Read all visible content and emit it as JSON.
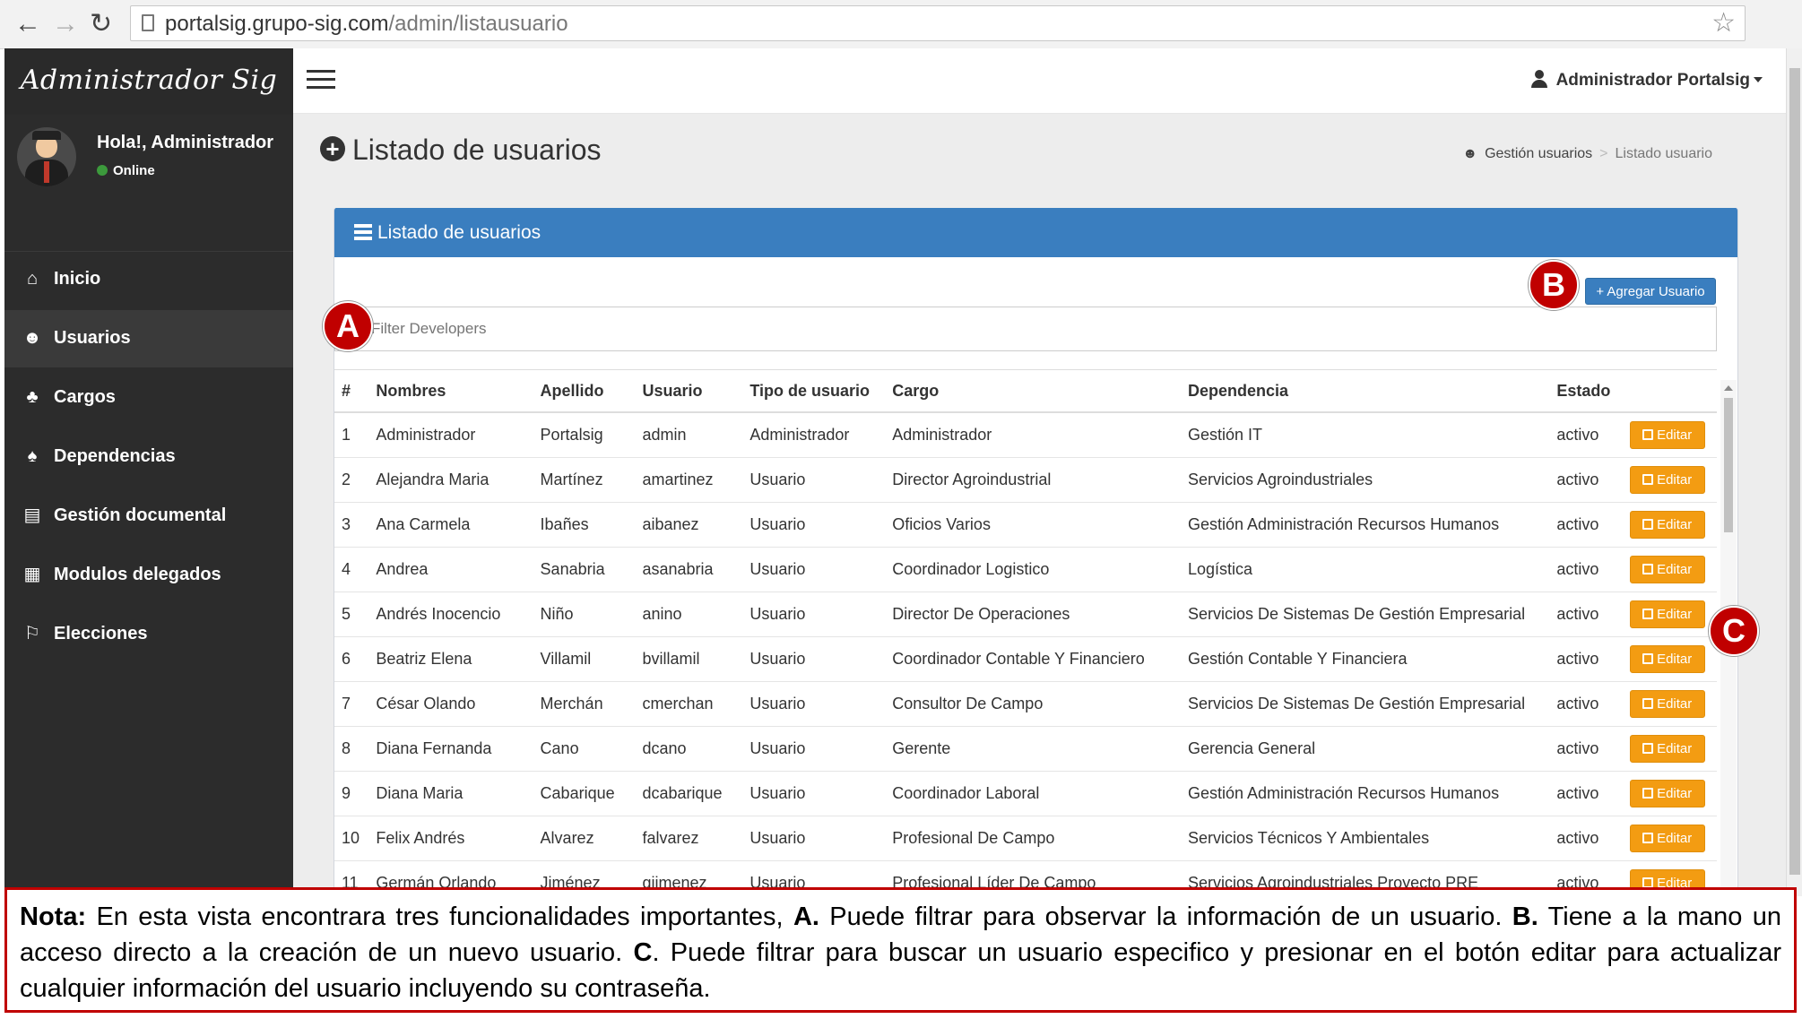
{
  "browser": {
    "url_host": "portalsig.grupo-sig.com",
    "url_path": "/admin/listausuario"
  },
  "sidebar": {
    "brand": "Administrador Sig",
    "user_greeting": "Hola!, Administrador",
    "user_status": "Online",
    "items": [
      {
        "label": "Inicio",
        "icon": "home-icon",
        "glyph": "⌂"
      },
      {
        "label": "Usuarios",
        "icon": "users-icon",
        "glyph": "☻"
      },
      {
        "label": "Cargos",
        "icon": "sitemap-icon",
        "glyph": "♣"
      },
      {
        "label": "Dependencias",
        "icon": "hierarchy-icon",
        "glyph": "♠"
      },
      {
        "label": "Gestión documental",
        "icon": "book-icon",
        "glyph": "▤"
      },
      {
        "label": "Modulos delegados",
        "icon": "grid-icon",
        "glyph": "▦"
      },
      {
        "label": "Elecciones",
        "icon": "flag-icon",
        "glyph": "⚐"
      }
    ],
    "active_index": 1
  },
  "header": {
    "user_name": "Administrador Portalsig"
  },
  "page": {
    "title": "Listado de usuarios",
    "breadcrumb": [
      "Gestión usuarios",
      "Listado usuario"
    ]
  },
  "panel": {
    "title": "Listado de usuarios",
    "add_button": "+ Agregar Usuario",
    "filter_placeholder": "Filter Developers",
    "edit_label": "Editar"
  },
  "table": {
    "columns": [
      "#",
      "Nombres",
      "Apellido",
      "Usuario",
      "Tipo de usuario",
      "Cargo",
      "Dependencia",
      "Estado",
      ""
    ],
    "rows": [
      [
        "1",
        "Administrador",
        "Portalsig",
        "admin",
        "Administrador",
        "Administrador",
        "Gestión IT",
        "activo"
      ],
      [
        "2",
        "Alejandra Maria",
        "Martínez",
        "amartinez",
        "Usuario",
        "Director Agroindustrial",
        "Servicios Agroindustriales",
        "activo"
      ],
      [
        "3",
        "Ana Carmela",
        "Ibañes",
        "aibanez",
        "Usuario",
        "Oficios Varios",
        "Gestión Administración Recursos Humanos",
        "activo"
      ],
      [
        "4",
        "Andrea",
        "Sanabria",
        "asanabria",
        "Usuario",
        "Coordinador Logistico",
        "Logística",
        "activo"
      ],
      [
        "5",
        "Andrés Inocencio",
        "Niño",
        "anino",
        "Usuario",
        "Director De Operaciones",
        "Servicios De Sistemas De Gestión Empresarial",
        "activo"
      ],
      [
        "6",
        "Beatriz Elena",
        "Villamil",
        "bvillamil",
        "Usuario",
        "Coordinador Contable Y Financiero",
        "Gestión Contable Y Financiera",
        "activo"
      ],
      [
        "7",
        "César Olando",
        "Merchán",
        "cmerchan",
        "Usuario",
        "Consultor De Campo",
        "Servicios De Sistemas De Gestión Empresarial",
        "activo"
      ],
      [
        "8",
        "Diana Fernanda",
        "Cano",
        "dcano",
        "Usuario",
        "Gerente",
        "Gerencia General",
        "activo"
      ],
      [
        "9",
        "Diana Maria",
        "Cabarique",
        "dcabarique",
        "Usuario",
        "Coordinador Laboral",
        "Gestión Administración Recursos Humanos",
        "activo"
      ],
      [
        "10",
        "Felix Andrés",
        "Alvarez",
        "falvarez",
        "Usuario",
        "Profesional De Campo",
        "Servicios Técnicos Y Ambientales",
        "activo"
      ],
      [
        "11",
        "Germán Orlando",
        "Jiménez",
        "gjimenez",
        "Usuario",
        "Profesional Líder De Campo",
        "Servicios Agroindustriales Proyecto PRE",
        "activo"
      ]
    ]
  },
  "markers": {
    "a": "A",
    "b": "B",
    "c": "C"
  },
  "note": {
    "lead": "Nota:",
    "text1": " En esta vista encontrara tres funcionalidades importantes, ",
    "a_label": "A.",
    "text2": " Puede filtrar para observar la información de un usuario. ",
    "b_label": "B.",
    "text3": " Tiene a la mano un acceso directo a la creación de un nuevo usuario. ",
    "c_label": "C",
    "text4": ". Puede filtrar para buscar un usuario especifico y presionar en el botón editar para actualizar cualquier información del usuario incluyendo su contraseña."
  }
}
